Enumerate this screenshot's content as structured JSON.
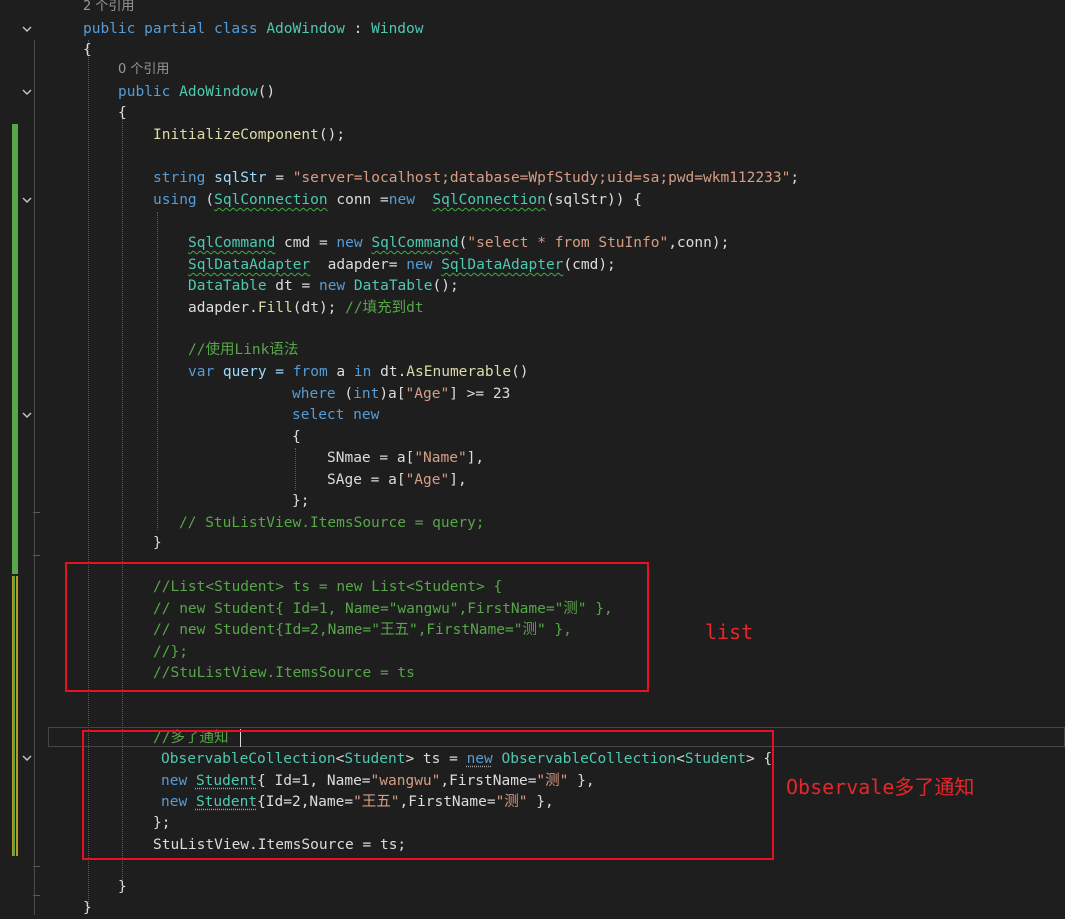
{
  "colors": {
    "background": "#1e1e1e",
    "keyword": "#569cd6",
    "type": "#4ec9b0",
    "string": "#d69d85",
    "comment": "#57a64a",
    "method": "#dcdcaa",
    "annotation_red": "#e81123",
    "change_bar_green": "#57a64a",
    "change_bar_yellow": "#c8a000"
  },
  "code": {
    "ref_2": "2 个引用",
    "class_decl": {
      "kw": "public partial class ",
      "name": "AdoWindow",
      "sep": " : ",
      "base": "Window"
    },
    "open_brace": "{",
    "ref_0": "0 个引用",
    "ctor": {
      "kw": "public ",
      "name": "AdoWindow",
      "parens": "()"
    },
    "ctor_open": "{",
    "init": {
      "name": "InitializeComponent",
      "rest": "();"
    },
    "sqlstr": {
      "kw": "string ",
      "var": "sqlStr",
      "eq": " = ",
      "str": "\"server=localhost;database=WpfStudy;uid=sa;pwd=wkm112233\"",
      "end": ";"
    },
    "using": {
      "kw": "using",
      "p1": " (",
      "t1": "SqlConnection",
      "p2": " conn =",
      "kw2": "new",
      "p3": "  ",
      "t2": "SqlConnection",
      "p4": "(sqlStr)) {"
    },
    "cmd": {
      "t1": "SqlCommand",
      "p1": " cmd = ",
      "kw": "new",
      "p2": " ",
      "t2": "SqlCommand",
      "p3": "(",
      "str": "\"select * from StuInfo\"",
      "p4": ",conn);"
    },
    "adapter": {
      "t1": "SqlDataAdapter",
      "p1": "  adapder= ",
      "kw": "new",
      "p2": " ",
      "t2": "SqlDataAdapter",
      "p3": "(cmd);"
    },
    "dt": {
      "t1": "DataTable",
      "p1": " dt = ",
      "kw": "new",
      "p2": " ",
      "t2": "DataTable",
      "p3": "();"
    },
    "fill": {
      "p1": "adapder.",
      "fn": "Fill",
      "p2": "(dt); ",
      "cm": "//填充到dt"
    },
    "link_comment": "//使用Link语法",
    "query": {
      "kw1": "var",
      "p1": " query = ",
      "kw2": "from",
      "p2": " a ",
      "kw3": "in",
      "p3": " dt.",
      "fn": "AsEnumerable",
      "p4": "()"
    },
    "where": {
      "kw": "where",
      "p1": " (",
      "kw2": "int",
      "p2": ")a[",
      "str": "\"Age\"",
      "p3": "] >= 23"
    },
    "select": {
      "kw": "select",
      "p1": " ",
      "kw2": "new"
    },
    "anon_open": "{",
    "sname": {
      "p1": "SNmae = a[",
      "str": "\"Name\"",
      "p2": "],"
    },
    "sage": {
      "p1": "SAge = a[",
      "str": "\"Age\"",
      "p2": "],"
    },
    "anon_close": "};",
    "itemssource_comment": "// StuListView.ItemsSource = query;",
    "using_close": "}",
    "list_c1": "//List<Student> ts = new List<Student> {",
    "list_c2": "// new Student{ Id=1, Name=\"wangwu\",FirstName=\"测\" },",
    "list_c3": "// new Student{Id=2,Name=\"王五\",FirstName=\"测\" },",
    "list_c4": "//};",
    "list_c5": "//StuListView.ItemsSource = ts",
    "notify_comment": "//多了通知",
    "obs": {
      "t1": "ObservableCollection",
      "p1": "<",
      "t2": "Student",
      "p2": "> ts = ",
      "kw": "new",
      "p3": " ",
      "t3": "ObservableCollection",
      "p4": "<",
      "t4": "Student",
      "p5": "> {"
    },
    "obs1": {
      "kw": "new",
      "p1": " ",
      "t": "Student",
      "p2": "{ Id=1, Name=",
      "s1": "\"wangwu\"",
      "p3": ",FirstName=",
      "s2": "\"测\"",
      "p4": " },"
    },
    "obs2": {
      "kw": "new",
      "p1": " ",
      "t": "Student",
      "p2": "{Id=2,Name=",
      "s1": "\"王五\"",
      "p3": ",FirstName=",
      "s2": "\"测\"",
      "p4": " },"
    },
    "obs_close": "};",
    "assign": "StuListView.ItemsSource = ts;",
    "ctor_close": "}",
    "class_close": "}"
  },
  "annotations": {
    "list_label": "list",
    "observable_label": "Observale多了通知"
  }
}
